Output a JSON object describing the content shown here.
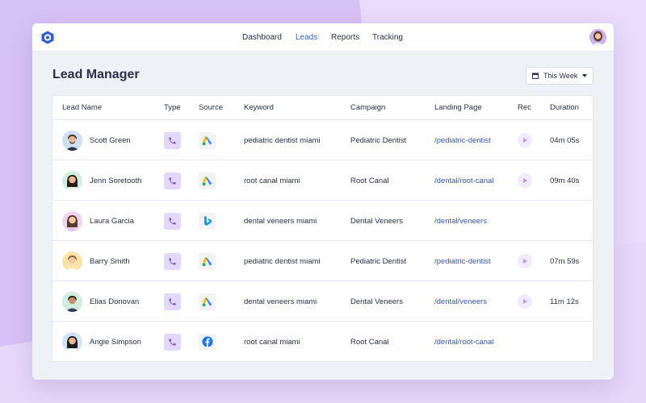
{
  "nav": {
    "items": [
      {
        "label": "Dashboard",
        "active": false
      },
      {
        "label": "Leads",
        "active": true
      },
      {
        "label": "Reports",
        "active": false
      },
      {
        "label": "Tracking",
        "active": false
      }
    ]
  },
  "page": {
    "title": "Lead Manager",
    "date_filter": "This Week"
  },
  "table": {
    "columns": [
      "Lead Name",
      "Type",
      "Source",
      "Keyword",
      "Campaign",
      "Landing Page",
      "Rec",
      "Duration"
    ],
    "rows": [
      {
        "name": "Scott Green",
        "type": "phone-icon",
        "source": "google-ads-icon",
        "keyword": "pediatric dentist miami",
        "campaign": "Pediatric Dentist",
        "landing_page": "/pediatric-dentist",
        "rec": true,
        "duration": "04m 05s"
      },
      {
        "name": "Jenn Soretooth",
        "type": "phone-icon",
        "source": "google-ads-icon",
        "keyword": "root canal miami",
        "campaign": "Root Canal",
        "landing_page": "/dental/root-canal",
        "rec": true,
        "duration": "09m 40s"
      },
      {
        "name": "Laura Garcia",
        "type": "phone-icon",
        "source": "bing-icon",
        "keyword": "dental veneers miami",
        "campaign": "Dental Veneers",
        "landing_page": "/dental/veneers",
        "rec": false,
        "duration": ""
      },
      {
        "name": "Barry Smith",
        "type": "phone-icon",
        "source": "google-ads-icon",
        "keyword": "pediatric dentist miami",
        "campaign": "Pediatric Dentist",
        "landing_page": "/pediatric-dentist",
        "rec": true,
        "duration": "07m 59s"
      },
      {
        "name": "Elias Donovan",
        "type": "phone-icon",
        "source": "google-ads-icon",
        "keyword": "dental veneers miami",
        "campaign": "Dental Veneers",
        "landing_page": "/dental/veneers",
        "rec": true,
        "duration": "11m 12s"
      },
      {
        "name": "Angie Simpson",
        "type": "phone-icon",
        "source": "facebook-icon",
        "keyword": "root canal miami",
        "campaign": "Root Canal",
        "landing_page": "/dental/root-canal",
        "rec": false,
        "duration": ""
      }
    ]
  },
  "colors": {
    "accent": "#3a62b7",
    "link": "#3656ac",
    "type_bg": "#e3d8fb",
    "phone": "#7b5cc4"
  }
}
